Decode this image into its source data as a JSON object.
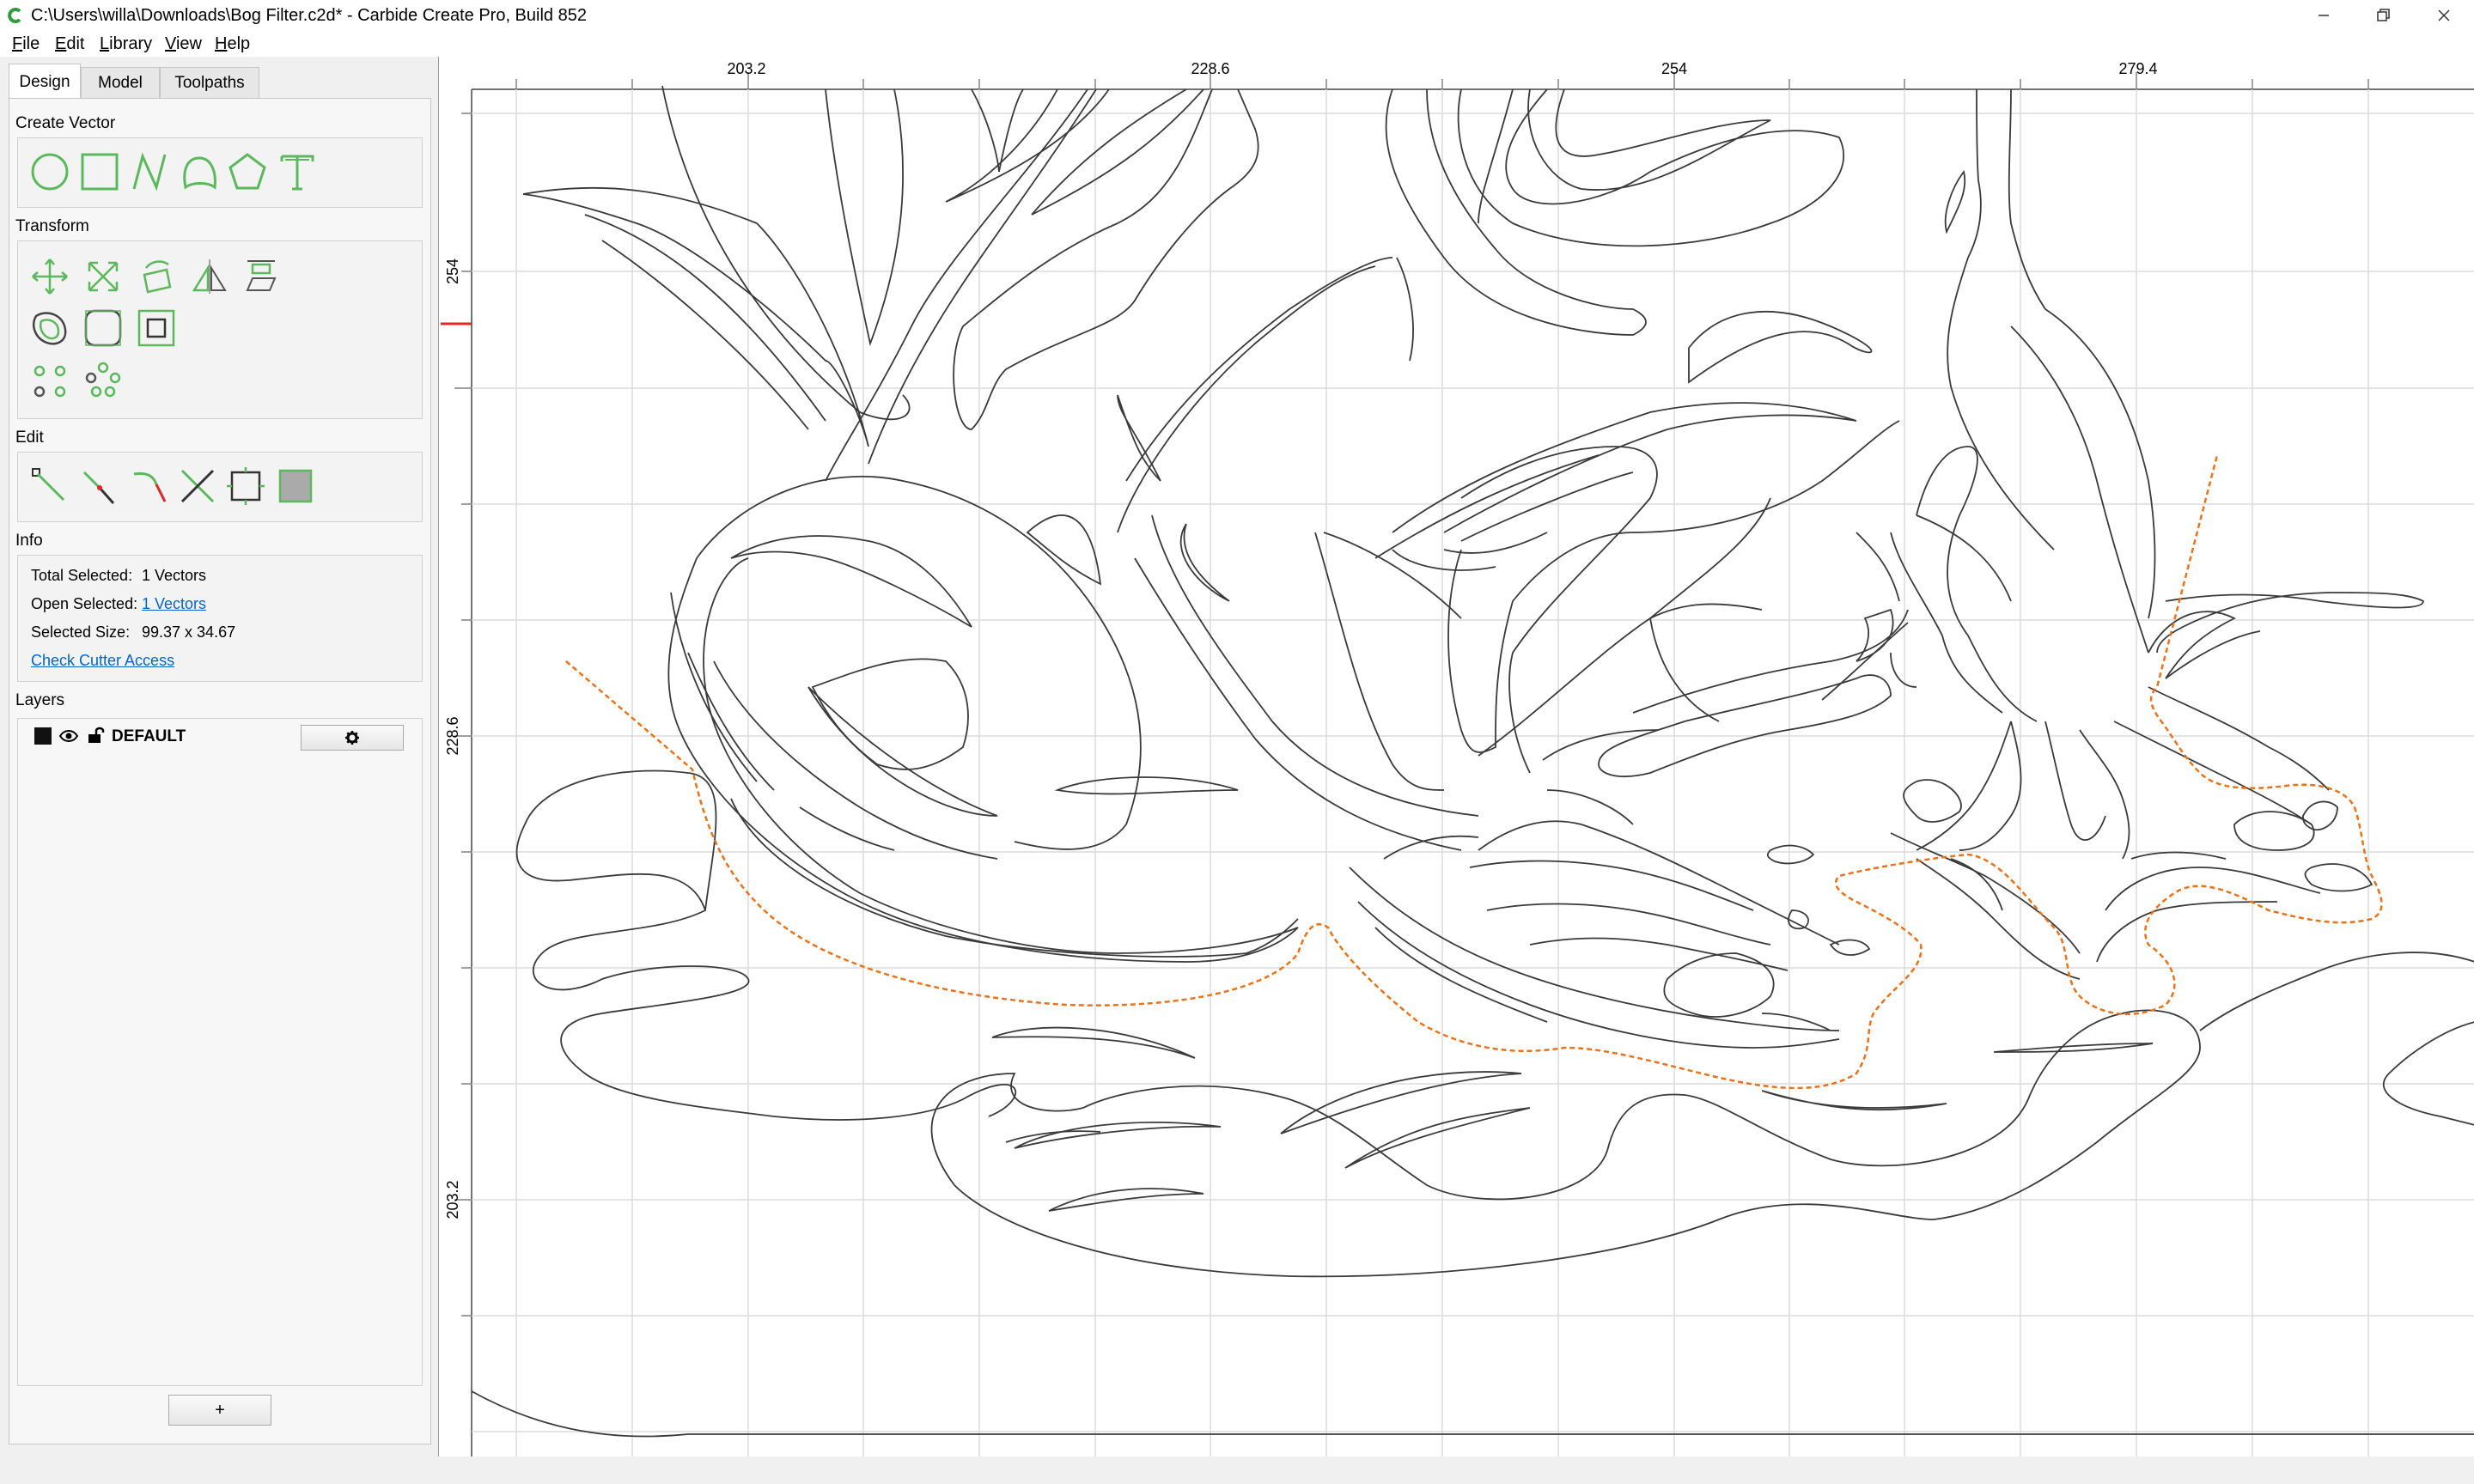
{
  "window": {
    "title": "C:\\Users\\willa\\Downloads\\Bog Filter.c2d* - Carbide Create Pro, Build 852"
  },
  "menu": {
    "file": {
      "key": "F",
      "rest": "ile"
    },
    "edit": {
      "key": "E",
      "rest": "dit"
    },
    "library": {
      "key": "L",
      "rest": "ibrary"
    },
    "view": {
      "key": "V",
      "rest": "iew"
    },
    "help": {
      "key": "H",
      "rest": "elp"
    }
  },
  "tabs": {
    "design": "Design",
    "model": "Model",
    "toolpaths": "Toolpaths"
  },
  "sections": {
    "create_vector": "Create Vector",
    "transform": "Transform",
    "edit": "Edit",
    "info": "Info",
    "layers": "Layers"
  },
  "info": {
    "total_selected_label": "Total Selected:",
    "total_selected_value": "1 Vectors",
    "open_selected_label": "Open Selected:",
    "open_selected_value": "1 Vectors",
    "selected_size_label": "Selected Size:",
    "selected_size_value": "99.37 x 34.67",
    "check_cutter_access": "Check Cutter Access"
  },
  "layers": {
    "items": [
      {
        "name": "DEFAULT",
        "color": "#111111"
      }
    ],
    "add_label": "+"
  },
  "rulers": {
    "top_ticks": [
      "203.2",
      "228.6",
      "254",
      "279.4"
    ],
    "left_ticks": [
      "254",
      "228.6",
      "203.2"
    ]
  },
  "colors": {
    "accent_green": "#5cb85c",
    "selection_orange": "#e8731a",
    "ruler_marker_red": "#e0282c"
  }
}
